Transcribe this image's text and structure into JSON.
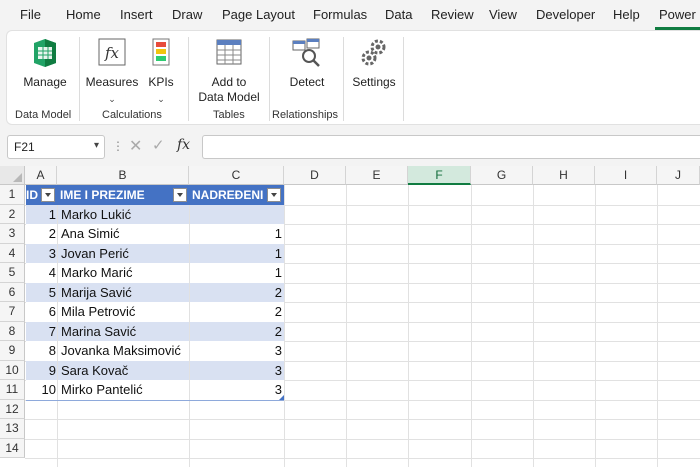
{
  "menu": {
    "tabs": [
      "File",
      "Home",
      "Insert",
      "Draw",
      "Page Layout",
      "Formulas",
      "Data",
      "Review",
      "View",
      "Developer",
      "Help",
      "Power"
    ]
  },
  "ribbon": {
    "manage": "Manage",
    "measures": "Measures",
    "kpis": "KPIs",
    "add_to": "Add to",
    "data_model": "Data Model",
    "detect": "Detect",
    "settings": "Settings",
    "groups": {
      "data_model": "Data Model",
      "calculations": "Calculations",
      "tables": "Tables",
      "relationships": "Relationships"
    },
    "chevron": "⌄"
  },
  "formula_bar": {
    "name_box": "F21",
    "fx": "fx",
    "value": ""
  },
  "grid": {
    "columns": [
      "A",
      "B",
      "C",
      "D",
      "E",
      "F",
      "G",
      "H",
      "I",
      "J"
    ],
    "rows": [
      "1",
      "2",
      "3",
      "4",
      "5",
      "6",
      "7",
      "8",
      "9",
      "10",
      "11",
      "12",
      "13",
      "14"
    ],
    "selected_column": "F"
  },
  "table": {
    "headers": [
      "ID",
      "IME I PREZIME",
      "NADREĐENI"
    ],
    "header_color": "#4472c4",
    "band_color": "#d9e1f2",
    "rows": [
      {
        "id": "1",
        "name": "Marko Lukić",
        "boss": ""
      },
      {
        "id": "2",
        "name": "Ana Simić",
        "boss": "1"
      },
      {
        "id": "3",
        "name": "Jovan Perić",
        "boss": "1"
      },
      {
        "id": "4",
        "name": "Marko Marić",
        "boss": "1"
      },
      {
        "id": "5",
        "name": "Marija Savić",
        "boss": "2"
      },
      {
        "id": "6",
        "name": "Mila Petrović",
        "boss": "2"
      },
      {
        "id": "7",
        "name": "Marina Savić",
        "boss": "2"
      },
      {
        "id": "8",
        "name": "Jovanka Maksimović",
        "boss": "3"
      },
      {
        "id": "9",
        "name": "Sara Kovač",
        "boss": "3"
      },
      {
        "id": "10",
        "name": "Mirko Pantelić",
        "boss": "3"
      }
    ]
  }
}
